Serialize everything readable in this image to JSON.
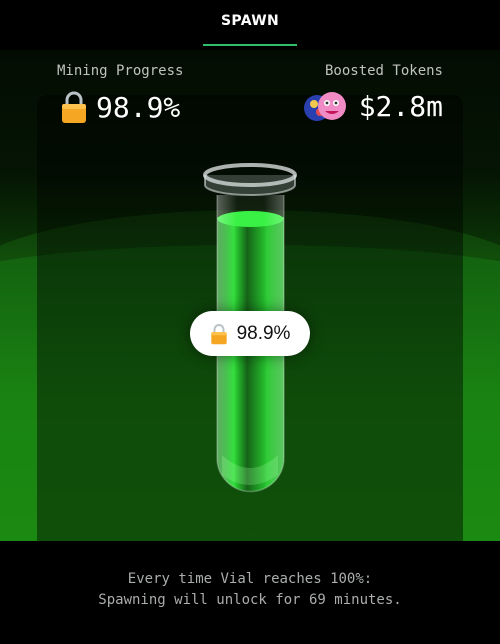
{
  "header": {
    "tab_label": "SPAWN"
  },
  "stats": {
    "mining_progress": {
      "label": "Mining Progress",
      "value": "98.9%"
    },
    "boosted_tokens": {
      "label": "Boosted Tokens",
      "value": "$2.8m"
    }
  },
  "vial": {
    "badge_value": "98.9%",
    "fill_fraction": 0.989
  },
  "footer": {
    "line1": "Every time Vial reaches 100%:",
    "line2": "Spawning will unlock for 69 minutes."
  },
  "colors": {
    "accent": "#2fbf6a",
    "liquid": "#1fdc2a",
    "lock": "#f5a623"
  },
  "icons": {
    "lock": "lock-icon",
    "tokens": "token-avatars-icon"
  }
}
